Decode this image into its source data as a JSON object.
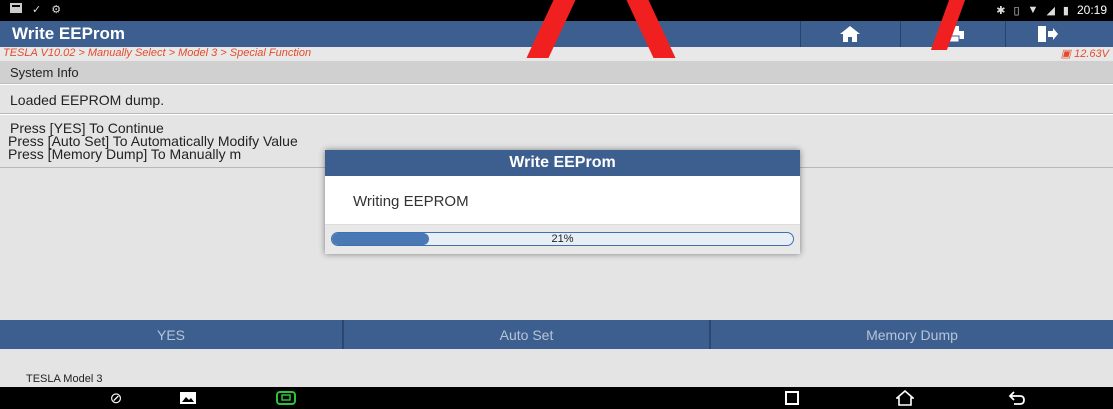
{
  "status_bar": {
    "left_icons": [
      "notification-icon",
      "wifi-check-icon",
      "settings-icon"
    ],
    "right_icons": [
      "bluetooth-icon",
      "vibrate-icon",
      "wifi-icon",
      "signal-icon",
      "battery-icon"
    ],
    "time": "20:19"
  },
  "titlebar": {
    "title": "Write EEProm",
    "buttons": [
      "home-icon",
      "print-icon",
      "exit-icon"
    ]
  },
  "breadcrumb": {
    "path": "TESLA V10.02 > Manually Select > Model 3 > Special Function",
    "voltage": "12.63V"
  },
  "system_info": {
    "label": "System Info"
  },
  "loaded_message": "Loaded EEPROM dump.",
  "instructions": [
    "Press [YES] To Continue",
    "Press [Auto Set] To Automatically Modify Value",
    "Press [Memory Dump] To Manually m"
  ],
  "actions": {
    "yes": "YES",
    "auto_set": "Auto Set",
    "memory_dump": "Memory Dump"
  },
  "footer": {
    "vehicle": "TESLA Model 3"
  },
  "modal": {
    "title": "Write EEProm",
    "message": "Writing EEPROM",
    "progress": 0.21,
    "progress_label": "21%"
  },
  "colors": {
    "accent": "#3d5f8f",
    "breadcrumb_text": "#e64b2a",
    "progress_fill": "#4a78b5"
  },
  "nav_bar": {
    "left_icons": [
      "browser-icon",
      "gallery-icon",
      "vci-icon"
    ],
    "right_icons": [
      "recents-icon",
      "home-icon",
      "back-icon"
    ]
  }
}
